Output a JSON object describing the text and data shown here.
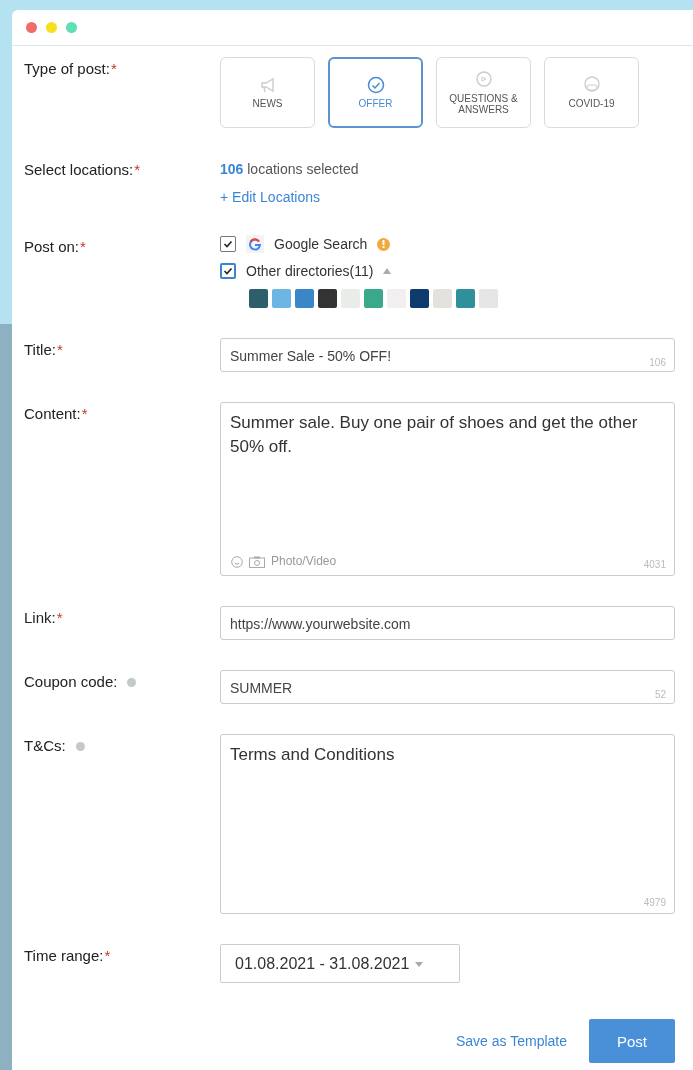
{
  "rows": [
    {
      "kind": "post_types",
      "label": "Type of post:",
      "required_mark": "*",
      "options": [
        {
          "label": "NEWS",
          "selected": false
        },
        {
          "label": "OFFER",
          "selected": true
        },
        {
          "label": "QUESTIONS & ANSWERS",
          "selected": false
        },
        {
          "label": "COVID-19",
          "selected": false
        }
      ]
    },
    {
      "kind": "locations",
      "label": "Select locations:",
      "required_mark": "*",
      "count": "106",
      "text": "locations selected",
      "link": "+ Edit Locations"
    },
    {
      "kind": "post_on",
      "label": "Post on:",
      "required_mark": "*",
      "targets": [
        {
          "kind": "google",
          "label": "Google Search",
          "checked": true,
          "warning": true
        },
        {
          "kind": "group",
          "label": "Other directories(11)",
          "checked": true,
          "expanded": true
        }
      ]
    },
    {
      "kind": "input",
      "label": "Title:",
      "required_mark": "*",
      "info": false,
      "value": "Summer Sale - 50% OFF!",
      "counter": "106"
    },
    {
      "kind": "textarea",
      "label": "Content:",
      "required_mark": "*",
      "info": false,
      "value": "Summer sale. Buy one pair of shoes and get the other 50% off.",
      "media": "Photo/Video",
      "counter": "4031"
    },
    {
      "kind": "input",
      "label": "Link:",
      "required_mark": "*",
      "info": false,
      "value": "https://www.yourwebsite.com"
    },
    {
      "kind": "input",
      "label": "Coupon code:",
      "info": true,
      "value": "SUMMER",
      "counter": "52"
    },
    {
      "kind": "textarea",
      "label": "T&Cs:",
      "info": true,
      "value": "Terms and Conditions",
      "counter": "4979"
    },
    {
      "kind": "select",
      "label": "Time range:",
      "required_mark": "*",
      "value": "01.08.2021 - 31.08.2021"
    }
  ],
  "actions": [
    {
      "kind": "link",
      "label": "Save as Template"
    },
    {
      "kind": "primary",
      "label": "Post"
    }
  ]
}
